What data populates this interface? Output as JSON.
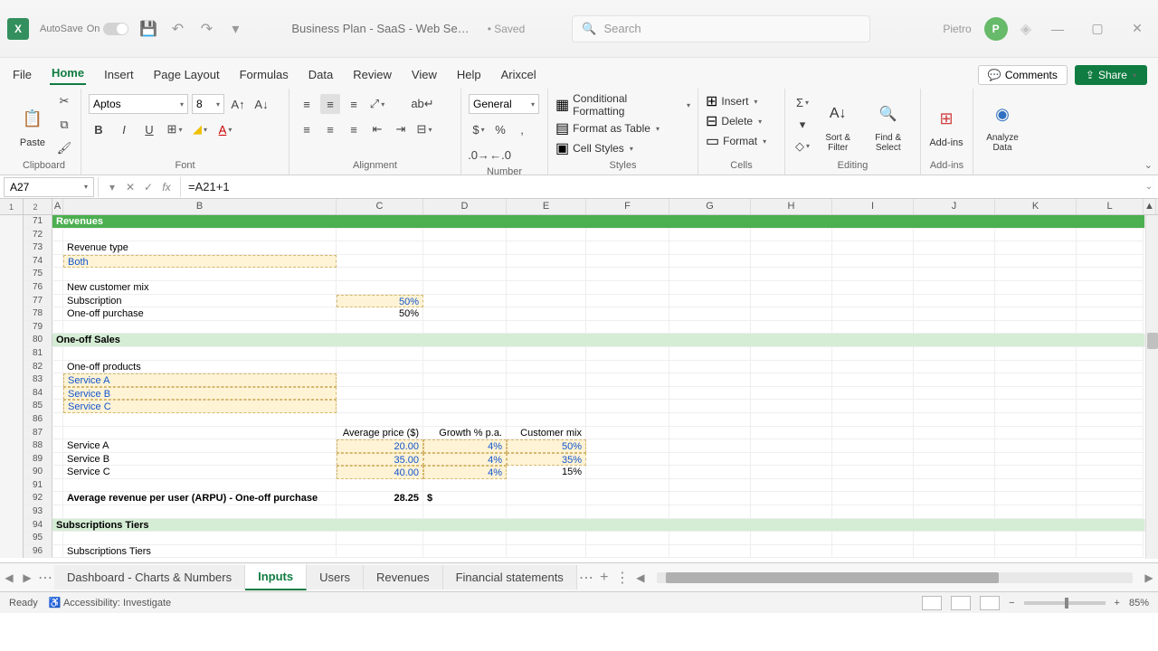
{
  "titlebar": {
    "autosave_label": "AutoSave",
    "autosave_state": "On",
    "doc_title": "Business Plan - SaaS - Web Se…",
    "saved_label": "• Saved",
    "search_placeholder": "Search",
    "user_name": "Pietro",
    "user_initial": "P"
  },
  "tabs": {
    "items": [
      "File",
      "Home",
      "Insert",
      "Page Layout",
      "Formulas",
      "Data",
      "Review",
      "View",
      "Help",
      "Arixcel"
    ],
    "active": "Home",
    "comments_label": "Comments",
    "share_label": "Share"
  },
  "ribbon": {
    "clipboard": {
      "paste": "Paste",
      "label": "Clipboard"
    },
    "font": {
      "name": "Aptos",
      "size": "8",
      "label": "Font"
    },
    "alignment": {
      "label": "Alignment"
    },
    "number": {
      "format": "General",
      "label": "Number"
    },
    "styles": {
      "cond": "Conditional Formatting",
      "table": "Format as Table",
      "cell": "Cell Styles",
      "label": "Styles"
    },
    "cells": {
      "insert": "Insert",
      "delete": "Delete",
      "format": "Format",
      "label": "Cells"
    },
    "editing": {
      "sort": "Sort & Filter",
      "find": "Find & Select",
      "label": "Editing"
    },
    "addins": {
      "btn": "Add-ins",
      "label": "Add-ins"
    },
    "analyze": {
      "btn": "Analyze Data"
    }
  },
  "formula_bar": {
    "cell_ref": "A27",
    "formula": "=A21+1"
  },
  "columns": [
    "A",
    "B",
    "C",
    "D",
    "E",
    "F",
    "G",
    "H",
    "I",
    "J",
    "K",
    "L"
  ],
  "row_start": 71,
  "rows": [
    {
      "r": 71,
      "type": "greenbar",
      "b": "Revenues"
    },
    {
      "r": 72
    },
    {
      "r": 73,
      "b": "Revenue type"
    },
    {
      "r": 74,
      "b": "Both",
      "b_class": "input-cell"
    },
    {
      "r": 75
    },
    {
      "r": 76,
      "b": "New customer mix"
    },
    {
      "r": 77,
      "b": "Subscription",
      "c": "50%",
      "c_class": "input-cell num"
    },
    {
      "r": 78,
      "b": "One-off purchase",
      "c": "50%",
      "c_class": "num"
    },
    {
      "r": 79
    },
    {
      "r": 80,
      "type": "lightgreen",
      "b": "One-off Sales"
    },
    {
      "r": 81
    },
    {
      "r": 82,
      "b": "One-off products"
    },
    {
      "r": 83,
      "b": "Service A",
      "b_class": "input-cell"
    },
    {
      "r": 84,
      "b": "Service B",
      "b_class": "input-cell"
    },
    {
      "r": 85,
      "b": "Service C",
      "b_class": "input-cell"
    },
    {
      "r": 86
    },
    {
      "r": 87,
      "c": "Average price ($)",
      "d": "Growth % p.a.",
      "e": "Customer mix",
      "c_class": "num",
      "d_class": "num",
      "e_class": "num"
    },
    {
      "r": 88,
      "b": "Service A",
      "c": "20.00",
      "d": "4%",
      "e": "50%",
      "c_class": "input-cell num",
      "d_class": "input-cell num",
      "e_class": "input-cell num"
    },
    {
      "r": 89,
      "b": "Service B",
      "c": "35.00",
      "d": "4%",
      "e": "35%",
      "c_class": "input-cell num",
      "d_class": "input-cell num",
      "e_class": "input-cell num"
    },
    {
      "r": 90,
      "b": "Service C",
      "c": "40.00",
      "d": "4%",
      "e": "15%",
      "c_class": "input-cell num",
      "d_class": "input-cell num",
      "e_class": "num"
    },
    {
      "r": 91
    },
    {
      "r": 92,
      "b": "Average revenue per user (ARPU) - One-off purchase",
      "b_class": "bold",
      "c": "28.25",
      "c_class": "num bold",
      "d": "$",
      "d_class": "bold"
    },
    {
      "r": 93
    },
    {
      "r": 94,
      "type": "lightgreen",
      "b": "Subscriptions Tiers"
    },
    {
      "r": 95
    },
    {
      "r": 96,
      "b": "Subscriptions Tiers"
    }
  ],
  "sheets": {
    "items": [
      "Dashboard - Charts & Numbers",
      "Inputs",
      "Users",
      "Revenues",
      "Financial statements"
    ],
    "active": "Inputs"
  },
  "status": {
    "ready": "Ready",
    "accessibility": "Accessibility: Investigate",
    "zoom": "85%"
  }
}
